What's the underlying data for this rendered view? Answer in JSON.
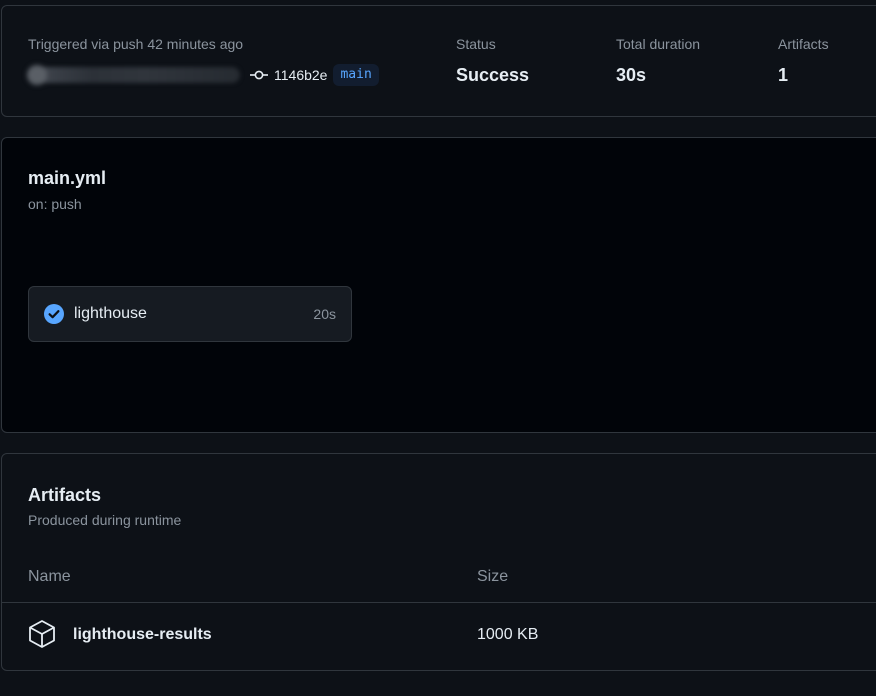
{
  "summary": {
    "trigger_text": "Triggered via push 42 minutes ago",
    "commit_sha": "1146b2e",
    "branch": "main",
    "status_label": "Status",
    "status_value": "Success",
    "duration_label": "Total duration",
    "duration_value": "30s",
    "artifacts_label": "Artifacts",
    "artifacts_value": "1"
  },
  "workflow": {
    "file_name": "main.yml",
    "trigger": "on: push",
    "job": {
      "name": "lighthouse",
      "duration": "20s",
      "status_color": "#58a6ff"
    }
  },
  "artifacts": {
    "title": "Artifacts",
    "subtitle": "Produced during runtime",
    "columns": [
      "Name",
      "Size"
    ],
    "rows": [
      {
        "name": "lighthouse-results",
        "size": "1000 KB",
        "icon": "package-icon"
      }
    ]
  }
}
